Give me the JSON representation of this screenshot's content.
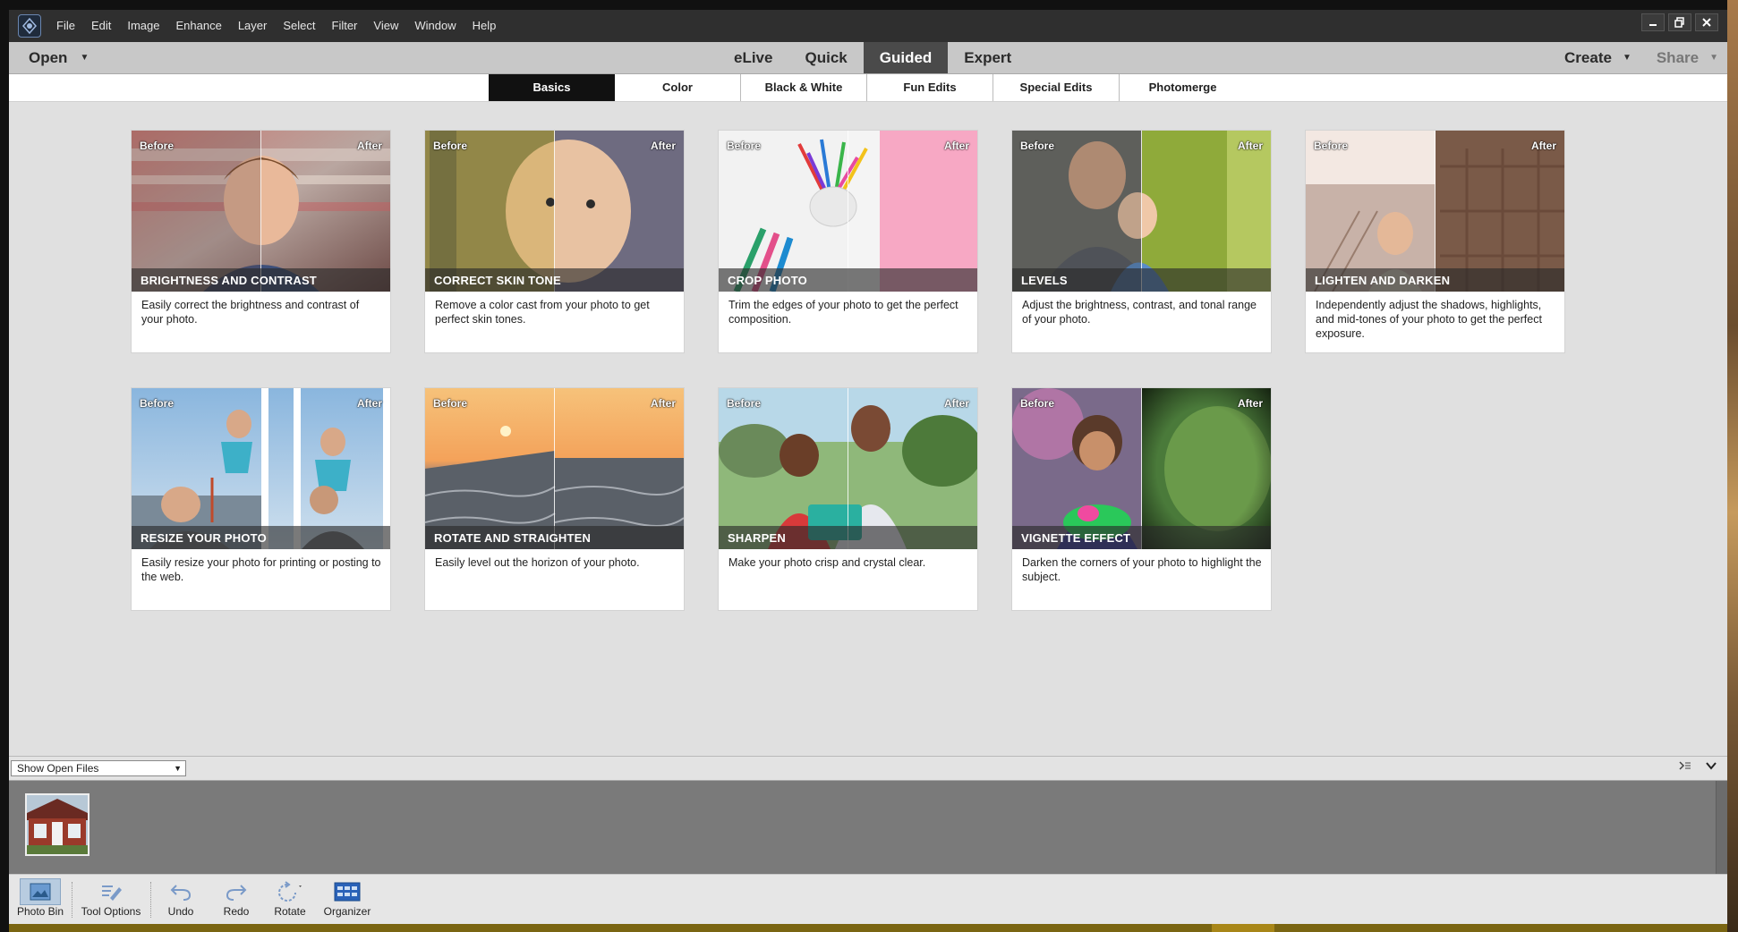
{
  "menubar": {
    "menus": [
      "File",
      "Edit",
      "Image",
      "Enhance",
      "Layer",
      "Select",
      "Filter",
      "View",
      "Window",
      "Help"
    ]
  },
  "modebar": {
    "open_label": "Open",
    "modes": [
      "eLive",
      "Quick",
      "Guided",
      "Expert"
    ],
    "active_mode": "Guided",
    "create_label": "Create",
    "share_label": "Share"
  },
  "subtabs": {
    "items": [
      "Basics",
      "Color",
      "Black & White",
      "Fun Edits",
      "Special Edits",
      "Photomerge"
    ],
    "active": "Basics"
  },
  "tags": {
    "before": "Before",
    "after": "After"
  },
  "cards": [
    {
      "title": "BRIGHTNESS AND CONTRAST",
      "desc": "Easily correct the brightness and contrast of your photo."
    },
    {
      "title": "CORRECT SKIN TONE",
      "desc": "Remove a color cast from your photo to get perfect skin tones."
    },
    {
      "title": "CROP PHOTO",
      "desc": "Trim the edges of your photo to get the perfect composition."
    },
    {
      "title": "LEVELS",
      "desc": "Adjust the brightness, contrast, and tonal range of your photo."
    },
    {
      "title": "LIGHTEN AND DARKEN",
      "desc": "Independently adjust the shadows, highlights, and mid-tones of your photo to get the perfect exposure."
    },
    {
      "title": "RESIZE YOUR PHOTO",
      "desc": "Easily resize your photo for printing or posting to the web."
    },
    {
      "title": "ROTATE AND STRAIGHTEN",
      "desc": "Easily level out the horizon of your photo."
    },
    {
      "title": "SHARPEN",
      "desc": "Make your photo crisp and crystal clear."
    },
    {
      "title": "VIGNETTE EFFECT",
      "desc": "Darken the corners of your photo to highlight the subject."
    }
  ],
  "bin": {
    "show_label": "Show Open Files"
  },
  "toolbar": {
    "photo_bin": "Photo Bin",
    "tool_options": "Tool Options",
    "undo": "Undo",
    "redo": "Redo",
    "rotate": "Rotate",
    "organizer": "Organizer"
  },
  "colors": {
    "menubar_bg": "#2f2f2f",
    "modebar_bg": "#c8c8c8",
    "active_tab_bg": "#111111",
    "workspace_bg": "#e0e0e0",
    "bin_bg": "#7a7a7a"
  }
}
